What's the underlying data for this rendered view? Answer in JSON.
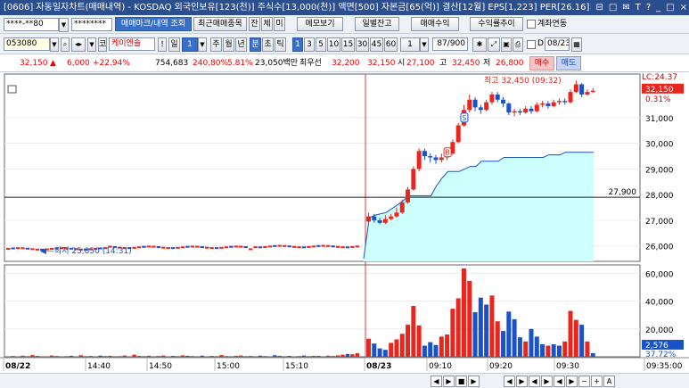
{
  "titlebar": {
    "title": "[0606] 자동일자차트(매매내역) - KOSDAQ 외국인보유[123(천)] 주식수[13,000(천)] 액면[500] 자본금[65(억)] 결산[12월] EPS[1,223] PER[26.16]",
    "ctrl_labels": [
      "⊟",
      "□",
      "✉",
      "T",
      "?",
      "_",
      "□",
      "×"
    ]
  },
  "row1": {
    "account": "****-**80",
    "password": "********",
    "trade_mark_btn": "매매마크/내역 조회",
    "recent_btn": "최근매매종목",
    "tab_jan": "잔",
    "tab_che": "체",
    "tab_mi": "미",
    "memo_btn": "메모보기",
    "daily_btn": "일별잔고",
    "trade_profit_btn": "매매수익",
    "profit_trend_btn": "수익률추이",
    "account_link_label": "계좌연동"
  },
  "row2": {
    "code": "053080",
    "market": "코",
    "name": "케이엔솔",
    "period_btn": "일",
    "period_val": "1",
    "week": "주",
    "month": "월",
    "year": "년",
    "minute": "분",
    "second": "초",
    "tick": "틱",
    "intervals": [
      "1",
      "3",
      "5",
      "10",
      "15",
      "30",
      "45",
      "60"
    ],
    "interval_sel": "1",
    "count": "87/900",
    "date_label": "D",
    "date": "08/23"
  },
  "row3": {
    "price": "32,150",
    "change": "6,000",
    "change_pct": "+22.94%",
    "volume": "754,683",
    "volume_pct": "240.80%",
    "turnover": "5.81%",
    "amount": "23,050백만",
    "ask_label": "최우선",
    "ask": "32,200",
    "bid": "32,150",
    "open_label": "시",
    "open": "27,100",
    "high_label": "고",
    "high": "32,450",
    "low_label": "저",
    "low": "26,800",
    "buy_btn": "매수",
    "sell_btn": "매도"
  },
  "chart_data": [
    {
      "type": "candlestick",
      "title": "",
      "y_axis_ticks": [
        "31,000",
        "30,000",
        "29,000",
        "28,000",
        "27,000",
        "26,000"
      ],
      "ylim": [
        25400,
        32700
      ],
      "lc_label": "LC:24.37",
      "current_price": "32,150",
      "current_pct": "0.31%",
      "ref_line_value": 27900,
      "ref_line_label": "27,900",
      "high_annotation": "최고 32,450 (09:32)",
      "low_annotation": "최저 25,850 (14:31)",
      "day1": {
        "open": 25900,
        "close": 25950,
        "low": 25850,
        "high": 26100,
        "bars": 73
      },
      "day2": {
        "candles": [
          {
            "o": 26950,
            "c": 27150,
            "h": 27300,
            "l": 26800
          },
          {
            "o": 27150,
            "c": 27000,
            "h": 27250,
            "l": 26900
          },
          {
            "o": 27000,
            "c": 26900,
            "h": 27100,
            "l": 26850
          },
          {
            "o": 26900,
            "c": 27050,
            "h": 27200,
            "l": 26850
          },
          {
            "o": 27050,
            "c": 27150,
            "h": 27250,
            "l": 27000
          },
          {
            "o": 27150,
            "c": 27300,
            "h": 27500,
            "l": 27100
          },
          {
            "o": 27300,
            "c": 27700,
            "h": 27800,
            "l": 27250
          },
          {
            "o": 27700,
            "c": 28200,
            "h": 28300,
            "l": 27650
          },
          {
            "o": 28200,
            "c": 29000,
            "h": 29100,
            "l": 28150
          },
          {
            "o": 29000,
            "c": 29700,
            "h": 29800,
            "l": 28900
          },
          {
            "o": 29700,
            "c": 29500,
            "h": 29800,
            "l": 29350
          },
          {
            "o": 29500,
            "c": 29450,
            "h": 29600,
            "l": 29250
          },
          {
            "o": 29450,
            "c": 29350,
            "h": 29550,
            "l": 29200
          },
          {
            "o": 29350,
            "c": 29450,
            "h": 29600,
            "l": 29250
          },
          {
            "o": 29450,
            "c": 29600,
            "h": 29700,
            "l": 29350
          },
          {
            "o": 29600,
            "c": 30050,
            "h": 30150,
            "l": 29550
          },
          {
            "o": 30050,
            "c": 30700,
            "h": 30800,
            "l": 30000
          },
          {
            "o": 30700,
            "c": 31300,
            "h": 31500,
            "l": 30650
          },
          {
            "o": 31300,
            "c": 31700,
            "h": 31900,
            "l": 31200
          },
          {
            "o": 31700,
            "c": 31400,
            "h": 31800,
            "l": 31250
          },
          {
            "o": 31400,
            "c": 31300,
            "h": 31500,
            "l": 31150
          },
          {
            "o": 31300,
            "c": 31600,
            "h": 31700,
            "l": 31250
          },
          {
            "o": 31600,
            "c": 31900,
            "h": 32000,
            "l": 31500
          },
          {
            "o": 31900,
            "c": 31700,
            "h": 32000,
            "l": 31600
          },
          {
            "o": 31700,
            "c": 31550,
            "h": 31800,
            "l": 31400
          },
          {
            "o": 31550,
            "c": 31200,
            "h": 31600,
            "l": 31100
          },
          {
            "o": 31200,
            "c": 31250,
            "h": 31350,
            "l": 31050
          },
          {
            "o": 31250,
            "c": 31200,
            "h": 31350,
            "l": 31100
          },
          {
            "o": 31200,
            "c": 31350,
            "h": 31450,
            "l": 31150
          },
          {
            "o": 31350,
            "c": 31250,
            "h": 31450,
            "l": 31150
          },
          {
            "o": 31250,
            "c": 31500,
            "h": 31600,
            "l": 31200
          },
          {
            "o": 31500,
            "c": 31550,
            "h": 31650,
            "l": 31400
          },
          {
            "o": 31550,
            "c": 31450,
            "h": 31650,
            "l": 31350
          },
          {
            "o": 31450,
            "c": 31600,
            "h": 31700,
            "l": 31400
          },
          {
            "o": 31600,
            "c": 31650,
            "h": 31750,
            "l": 31500
          },
          {
            "o": 31650,
            "c": 31600,
            "h": 31750,
            "l": 31500
          },
          {
            "o": 31600,
            "c": 32000,
            "h": 32100,
            "l": 31550
          },
          {
            "o": 32000,
            "c": 32300,
            "h": 32450,
            "l": 31950
          },
          {
            "o": 32300,
            "c": 31900,
            "h": 32350,
            "l": 31800
          },
          {
            "o": 31900,
            "c": 32000,
            "h": 32100,
            "l": 31850
          },
          {
            "o": 32000,
            "c": 32050,
            "h": 32150,
            "l": 31950
          }
        ]
      },
      "fill_line": [
        25500,
        27100,
        27200,
        27250,
        27300,
        27450,
        27600,
        27750,
        27950,
        27950,
        27950,
        27950,
        27950,
        28350,
        28650,
        28900,
        28900,
        28900,
        29000,
        29100,
        29100,
        29300,
        29300,
        29300,
        29300,
        29450,
        29450,
        29450,
        29450,
        29450,
        29450,
        29450,
        29450,
        29550,
        29550,
        29550,
        29650,
        29650,
        29650,
        29650
      ],
      "markers": [
        {
          "label": "S",
          "index": 17,
          "price": 31000
        },
        {
          "label": "B",
          "index": 14,
          "price": 29650
        }
      ]
    },
    {
      "type": "bar",
      "title": "",
      "y_axis_ticks": [
        "60,000",
        "40,000",
        "20,000"
      ],
      "ylim": [
        0,
        66000
      ],
      "current_volume": "2,576",
      "current_pct": "37.72%",
      "day1_volumes": [
        300,
        500,
        250,
        800,
        400,
        1200,
        600,
        200,
        350,
        900,
        500,
        300,
        450,
        700,
        250,
        1100,
        400,
        600,
        300,
        800,
        500,
        700,
        350,
        450,
        900,
        300,
        1500,
        600,
        400,
        750,
        350,
        500,
        900,
        300,
        600,
        450,
        1000,
        700,
        500,
        350,
        800,
        300,
        600,
        400,
        1200,
        500,
        300,
        700,
        900,
        400,
        600,
        350,
        800,
        500,
        300,
        1100,
        700,
        400,
        600,
        300,
        500,
        900,
        450,
        700,
        600,
        350,
        800,
        500,
        1000,
        1500,
        2000,
        1800,
        2500
      ],
      "day1_colors": "mixed",
      "day2_volumes": [
        {
          "v": 13000,
          "c": "r"
        },
        {
          "v": 9500,
          "c": "b"
        },
        {
          "v": 6000,
          "c": "b"
        },
        {
          "v": 5000,
          "c": "b"
        },
        {
          "v": 10000,
          "c": "r"
        },
        {
          "v": 12500,
          "c": "r"
        },
        {
          "v": 16500,
          "c": "r"
        },
        {
          "v": 23000,
          "c": "r"
        },
        {
          "v": 36500,
          "c": "r"
        },
        {
          "v": 22500,
          "c": "r"
        },
        {
          "v": 8000,
          "c": "b"
        },
        {
          "v": 10500,
          "c": "b"
        },
        {
          "v": 8500,
          "c": "b"
        },
        {
          "v": 14500,
          "c": "r"
        },
        {
          "v": 16000,
          "c": "r"
        },
        {
          "v": 34500,
          "c": "r"
        },
        {
          "v": 42000,
          "c": "r"
        },
        {
          "v": 63500,
          "c": "r"
        },
        {
          "v": 54500,
          "c": "r"
        },
        {
          "v": 32000,
          "c": "b"
        },
        {
          "v": 42500,
          "c": "b"
        },
        {
          "v": 37500,
          "c": "b"
        },
        {
          "v": 44000,
          "c": "r"
        },
        {
          "v": 25500,
          "c": "r"
        },
        {
          "v": 18500,
          "c": "b"
        },
        {
          "v": 32500,
          "c": "b"
        },
        {
          "v": 27000,
          "c": "b"
        },
        {
          "v": 14000,
          "c": "b"
        },
        {
          "v": 11000,
          "c": "r"
        },
        {
          "v": 20000,
          "c": "b"
        },
        {
          "v": 14500,
          "c": "b"
        },
        {
          "v": 9000,
          "c": "b"
        },
        {
          "v": 8000,
          "c": "r"
        },
        {
          "v": 9000,
          "c": "b"
        },
        {
          "v": 8000,
          "c": "b"
        },
        {
          "v": 11000,
          "c": "r"
        },
        {
          "v": 33000,
          "c": "r"
        },
        {
          "v": 26500,
          "c": "r"
        },
        {
          "v": 23000,
          "c": "b"
        },
        {
          "v": 11000,
          "c": "r"
        },
        {
          "v": 2576,
          "c": "b"
        }
      ]
    }
  ],
  "x_axis_labels": [
    "08/22",
    "14:40",
    "14:50",
    "15:00",
    "15:10",
    "08/23",
    "09:10",
    "09:20",
    "09:30",
    "09:35:00"
  ],
  "bottombar": {
    "nav_labels": [
      "◀",
      "▶",
      "■",
      "▶",
      "◀",
      "▶",
      "◀",
      "▶",
      "◀",
      "▶",
      "−",
      "+",
      "A"
    ]
  },
  "colors": {
    "up": "#e8261e",
    "down": "#1a52c8",
    "fill": "#ccfffe",
    "fill_line": "#1a52c8",
    "vline": "#e33"
  }
}
